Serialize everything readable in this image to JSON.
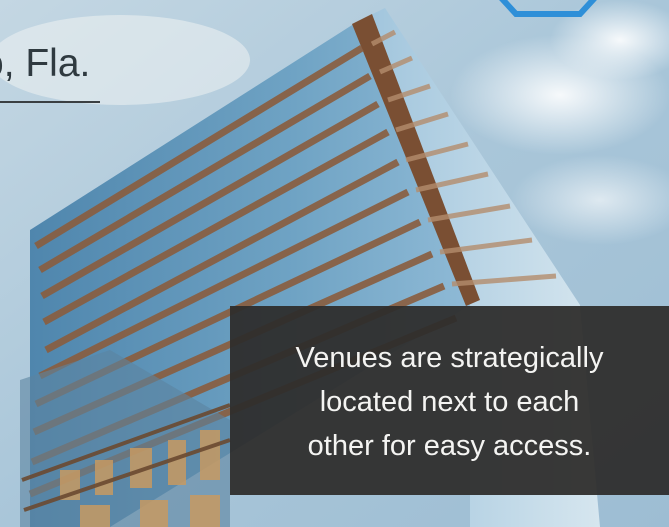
{
  "header": {
    "location": "o, Fla."
  },
  "caption": {
    "lines": [
      "Venues are strategically",
      "located next to each",
      "other for easy access."
    ]
  },
  "photo": {
    "subject_icon": "skyscraper-photo",
    "sky_color": "#a9c6d9",
    "glass_color": "#6fa3c4",
    "frame_color": "#8a5d3e"
  },
  "logo": {
    "icon": "hexagon-logo-icon",
    "color": "#2e8fd8"
  }
}
